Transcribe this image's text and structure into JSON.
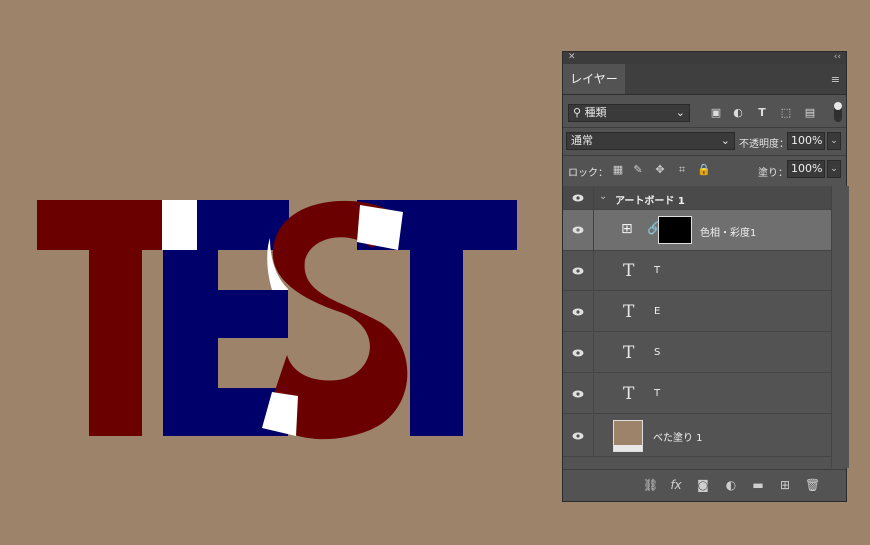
{
  "canvas": {
    "letters": [
      {
        "char": "T",
        "color": "#6b0000"
      },
      {
        "char": "E",
        "color": "#00006b"
      },
      {
        "char": "S",
        "color": "#6b0000"
      },
      {
        "char": "T",
        "color": "#00006b"
      }
    ]
  },
  "panel": {
    "close_glyph": "✕",
    "collapse_glyph": "‹‹",
    "tab_label": "レイヤー",
    "menu_icon": "≡",
    "filter": {
      "label": "種類",
      "icon": "search-icon"
    },
    "blend_mode": "通常",
    "opacity_label": "不透明度：",
    "opacity_value": "100%",
    "lock_label": "ロック：",
    "fill_label": "塗り：",
    "fill_value": "100%",
    "layers": [
      {
        "name": "アートボード 1",
        "kind": "artboard"
      },
      {
        "name": "色相・彩度1",
        "kind": "adjustment"
      },
      {
        "name": "T",
        "kind": "text"
      },
      {
        "name": "E",
        "kind": "text"
      },
      {
        "name": "S",
        "kind": "text"
      },
      {
        "name": "T",
        "kind": "text"
      },
      {
        "name": "べた塗り 1",
        "kind": "fill",
        "swatch": "#9c836a"
      }
    ],
    "footer_icons": [
      "link-icon",
      "fx-icon",
      "mask-icon",
      "adjustment-icon",
      "folder-icon",
      "new-layer-icon",
      "trash-icon"
    ]
  },
  "colors": {
    "background": "#9c836a",
    "dark_red": "#6b0000",
    "navy": "#00006b"
  }
}
